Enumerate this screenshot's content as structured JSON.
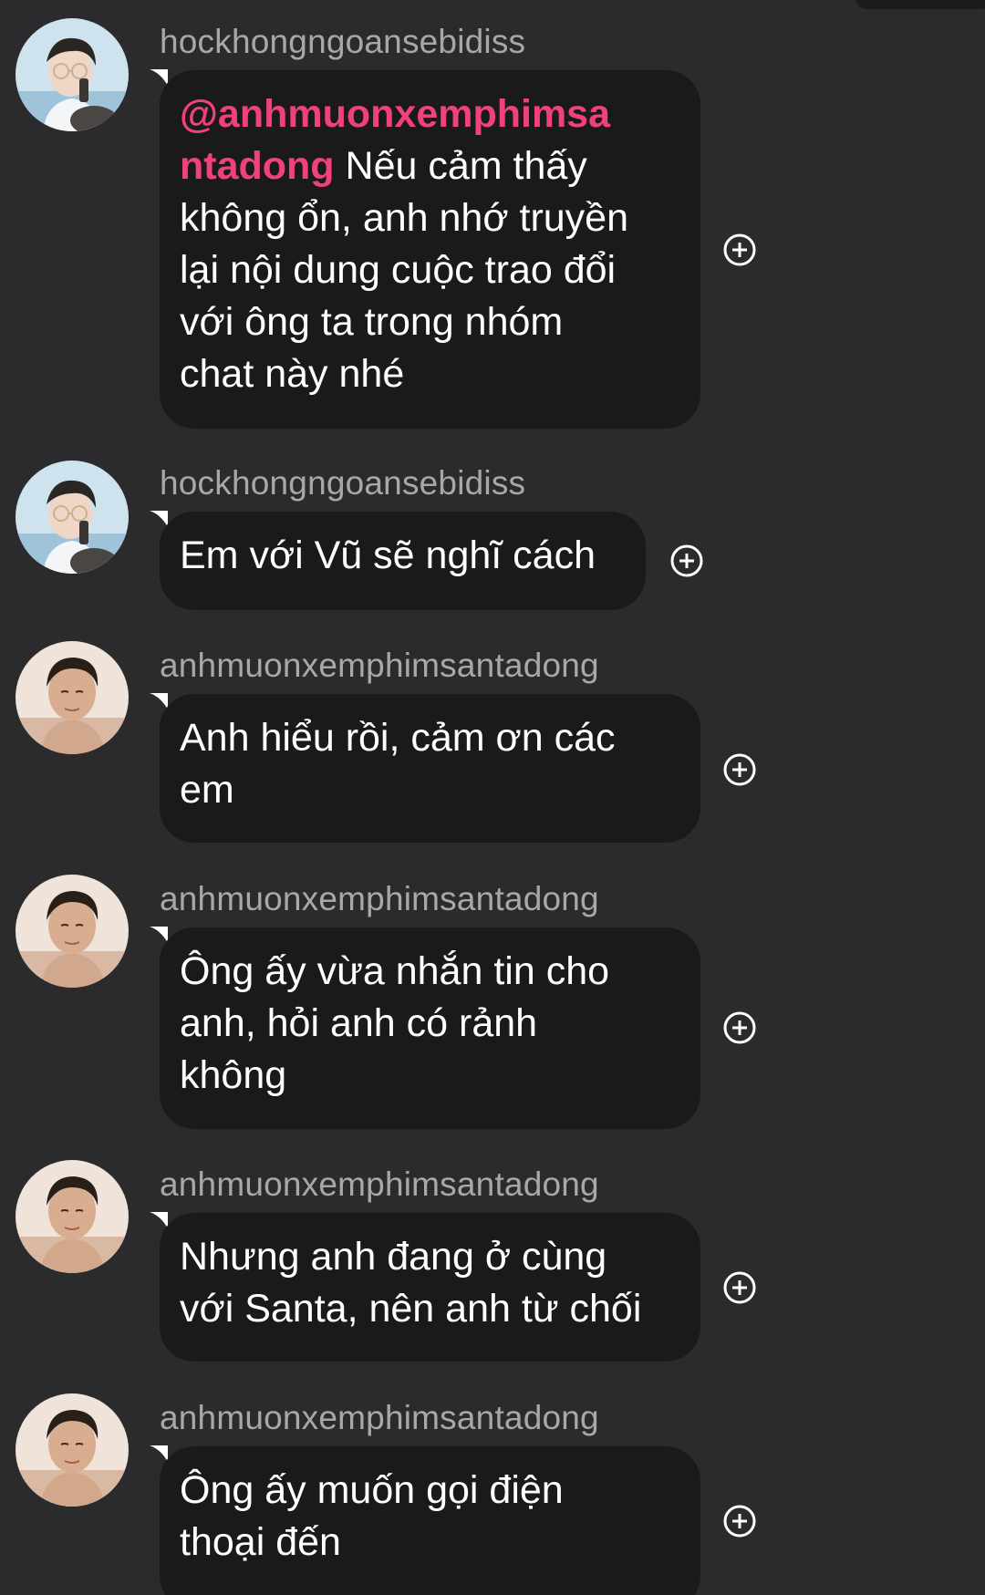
{
  "messages": [
    {
      "username": "hockhongngoansebidiss",
      "avatar": "avatar-user-glasses",
      "mention": "@anhmuonxemphimsa\nntadong",
      "text": " Nếu cảm thấy\nkhông ổn, anh nhớ truyền\nlại nội dung cuộc trao đổi\nvới ông ta trong nhóm\nchat này nhé",
      "react_icon": "add-reaction-icon"
    },
    {
      "username": "hockhongngoansebidiss",
      "avatar": "avatar-user-glasses",
      "text": "Em với Vũ sẽ nghĩ cách",
      "react_icon": "add-reaction-icon"
    },
    {
      "username": "anhmuonxemphimsantadong",
      "avatar": "avatar-user-man",
      "text": "Anh hiểu rồi, cảm ơn các\nem",
      "react_icon": "add-reaction-icon"
    },
    {
      "username": "anhmuonxemphimsantadong",
      "avatar": "avatar-user-man",
      "text": "Ông ấy vừa nhắn tin cho\nanh, hỏi anh có rảnh\nkhông",
      "react_icon": "add-reaction-icon"
    },
    {
      "username": "anhmuonxemphimsantadong",
      "avatar": "avatar-user-man",
      "text": "Nhưng anh đang ở cùng\nvới Santa, nên anh từ chối",
      "react_icon": "add-reaction-icon"
    },
    {
      "username": "anhmuonxemphimsantadong",
      "avatar": "avatar-user-man",
      "text": "Ông ấy muốn gọi điện\nthoại đến",
      "react_icon": "add-reaction-icon"
    }
  ],
  "colors": {
    "background": "#2b2b2d",
    "bubble": "#1a1a1a",
    "mention": "#f0417f",
    "username": "#a8a8aa"
  }
}
